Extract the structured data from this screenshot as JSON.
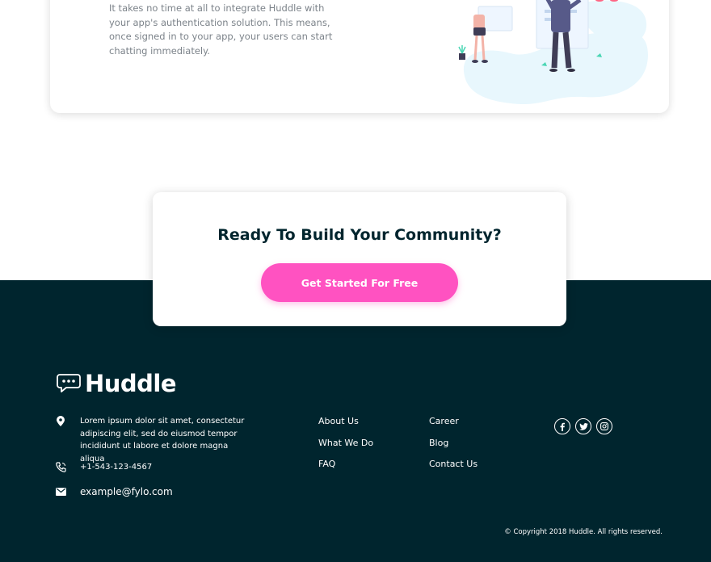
{
  "feature": {
    "description": "It takes no time at all to integrate Huddle with your app's authentication solution. This means, once signed in to your app, your users can start chatting immediately."
  },
  "cta": {
    "title": "Ready To Build Your Community?",
    "button_label": "Get Started For Free"
  },
  "footer": {
    "brand": "Huddle",
    "address": "Lorem ipsum dolor sit amet, consectetur adipiscing elit, sed do eiusmod tempor incididunt ut labore et dolore magna aliqua",
    "phone": "+1-543-123-4567",
    "email": "example@fylo.com",
    "links_col1": [
      "About Us",
      "What We Do",
      "FAQ"
    ],
    "links_col2": [
      "Career",
      "Blog",
      "Contact Us"
    ],
    "socials": [
      "facebook-icon",
      "twitter-icon",
      "instagram-icon"
    ],
    "copyright": "© Copyright 2018 Huddle. All rights reserved."
  },
  "colors": {
    "footer_bg": "#00252e",
    "accent": "#ff52c1",
    "body_text": "#7c838a",
    "heading": "#00252e"
  }
}
